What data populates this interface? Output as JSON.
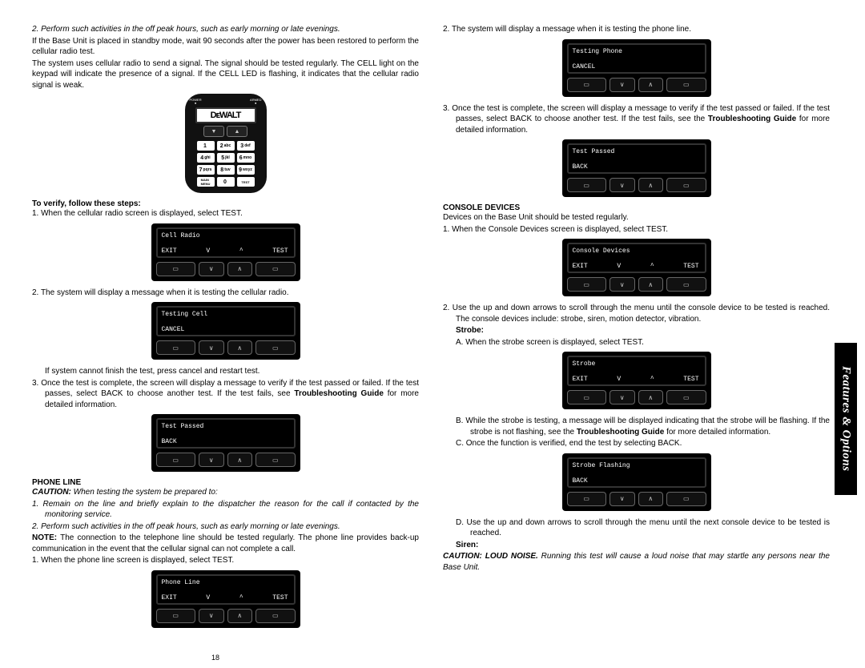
{
  "side_tab": "Features & Options",
  "page_number": "18",
  "keypad": {
    "brand": "DᴇWALT",
    "led_left": "POWER\n●",
    "led_right": "ARMED\n●",
    "arrow_left": "▼",
    "arrow_right": "▲",
    "keys": [
      "1",
      "2 abc",
      "3 def",
      "4 ghi",
      "5 jkl",
      "6 mno",
      "7 pqrs",
      "8 tuv",
      "9 wxyz",
      "MAIN\nMENU",
      "0",
      "TEST"
    ]
  },
  "lcd_cellradio": {
    "l1": "Cell Radio",
    "b1": "EXIT",
    "b2": "V",
    "b3": "^",
    "b4": "TEST"
  },
  "lcd_testcell": {
    "l1": "Testing Cell",
    "b1": "CANCEL"
  },
  "lcd_testpassed1": {
    "l1": "Test Passed",
    "b1": "BACK"
  },
  "lcd_phoneline": {
    "l1": "Phone Line",
    "b1": "EXIT",
    "b2": "V",
    "b3": "^",
    "b4": "TEST"
  },
  "lcd_testphone": {
    "l1": "Testing Phone",
    "b1": "CANCEL"
  },
  "lcd_testpassed2": {
    "l1": "Test Passed",
    "b1": "BACK"
  },
  "lcd_console": {
    "l1": "Console Devices",
    "b1": "EXIT",
    "b2": "V",
    "b3": "^",
    "b4": "TEST"
  },
  "lcd_strobe": {
    "l1": "Strobe",
    "b1": "EXIT",
    "b2": "V",
    "b3": "^",
    "b4": "TEST"
  },
  "lcd_strobeflash": {
    "l1": "Strobe Flashing",
    "b1": "BACK"
  },
  "left": {
    "p1": "2. Perform such activities in the off peak hours, such as early morning or late evenings.",
    "p2": "If the Base Unit is placed in standby mode, wait 90 seconds after the power has been restored to perform the cellular radio test.",
    "p3": "The system uses cellular radio to send a signal. The signal should be tested regularly. The CELL light on the keypad will indicate the presence of a signal. If the CELL LED is flashing, it indicates that the cellular radio signal is weak.",
    "h1": "To verify, follow these steps:",
    "s1": "1. When the cellular radio screen is displayed, select TEST.",
    "s2": "2. The system will display a message when it is testing the cellular radio.",
    "s3a": "If system cannot finish the test, press cancel and restart test.",
    "s3": "3. Once the test is complete, the screen will display a message to verify if the test passed or failed. If the test passes, select BACK to choose another test. If the test fails, see ",
    "s3b": "Troubleshooting Guide",
    "s3c": " for more detailed information.",
    "h2": "PHONE LINE",
    "pl_caution_label": "CAUTION:",
    "pl_caution_text": " When testing the system be prepared to:",
    "pl1": "1. Remain on the line and briefly explain to the dispatcher the reason for the call if contacted by the monitoring service.",
    "pl2": "2. Perform such activities in the off peak hours, such as early morning or late evenings.",
    "pl_note_label": "NOTE:",
    "pl_note_text": " The connection to the telephone line should be tested regularly. The phone line provides back-up communication in the event that the cellular signal can not complete a call.",
    "pl3": "1. When the phone line screen is displayed, select TEST."
  },
  "right": {
    "r1": "2. The system will display a message when it is testing the phone line.",
    "r2a": "3. Once the test is complete, the screen will display a message to verify if the test passed or failed. If the test passes, select BACK to choose another test. If the test fails, see the ",
    "r2b": "Troubleshooting Guide",
    "r2c": " for more detailed information.",
    "h1": "CONSOLE DEVICES",
    "c1": "Devices on the Base Unit should be tested regularly.",
    "c2": "1. When the Console Devices screen is displayed, select TEST.",
    "c3": "2. Use the up and down arrows to scroll through the menu until the console device to be tested is reached. The console devices include: strobe, siren, motion detector, vibration.",
    "h_strobe": "Strobe:",
    "sA": "A. When the strobe screen is displayed, select TEST.",
    "sB1": "B. While the strobe is testing, a message will be displayed indicating that the strobe will be flashing. If the strobe is not flashing, see the ",
    "sB2": "Troubleshooting Guide",
    "sB3": " for more detailed information.",
    "sC": "C. Once the function is verified, end the test by selecting BACK.",
    "sD": "D. Use the up and down arrows to scroll through the menu until the next console device to be tested is reached.",
    "h_siren": "Siren:",
    "siren_caution1": "CAUTION: LOUD NOISE.",
    "siren_caution2": " Running this test will cause a loud noise that may startle any persons near the Base Unit."
  }
}
